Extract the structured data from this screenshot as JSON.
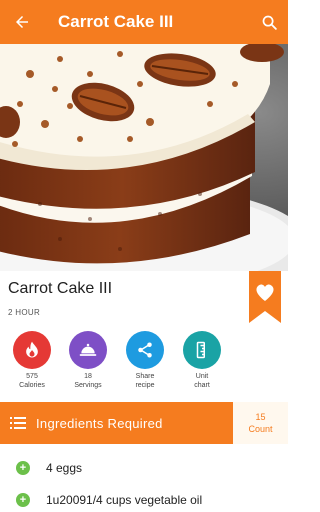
{
  "appbar": {
    "title": "Carrot Cake III",
    "back_icon": "arrow-left-icon",
    "search_icon": "search-icon",
    "color": "#F57C1F"
  },
  "recipe": {
    "title": "Carrot Cake III",
    "time": "2 HOUR"
  },
  "actions": [
    {
      "name": "calories",
      "value": "575",
      "label": "Calories",
      "icon": "flame-icon",
      "color": "#E53935"
    },
    {
      "name": "servings",
      "value": "18",
      "label": "Servings",
      "icon": "cloche-icon",
      "color": "#7E4FC6"
    },
    {
      "name": "share",
      "value": "Share",
      "label": "recipe",
      "icon": "share-icon",
      "color": "#1E9BE0"
    },
    {
      "name": "unit-chart",
      "value": "Unit",
      "label": "chart",
      "icon": "ruler-icon",
      "color": "#1AA3A5"
    }
  ],
  "ingredients": {
    "header": "Ingredients Required",
    "count_value": "15",
    "count_label": "Count",
    "items": [
      {
        "text": "4 eggs"
      },
      {
        "text": "1u20091/4 cups vegetable oil"
      }
    ]
  }
}
